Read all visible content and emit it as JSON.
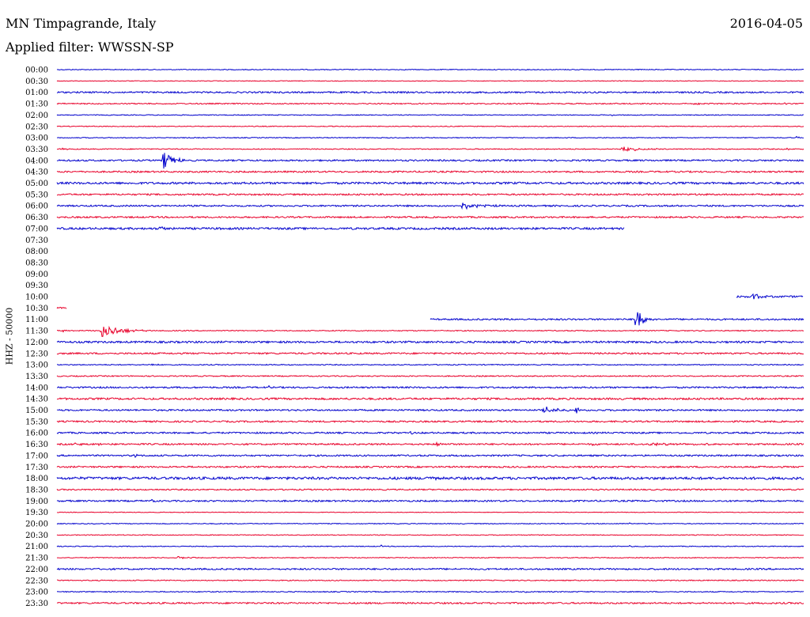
{
  "header": {
    "station": "MN Timpagrande, Italy",
    "date": "2016-04-05",
    "filter_label": "Applied filter: WWSSN-SP"
  },
  "chart_data": {
    "type": "line",
    "ylabel": "HHZ - 50000",
    "colors": {
      "even_hour": "#0000cc",
      "half_hour": "#e8002a"
    },
    "row_minutes": 30,
    "rows": [
      {
        "label": "00:00",
        "start": 0,
        "end": 30,
        "noise": 0.5,
        "events": [
          {
            "t": 20.7,
            "amp": 2,
            "dur": 0.2
          }
        ]
      },
      {
        "label": "00:30",
        "start": 0,
        "end": 30,
        "noise": 0.4,
        "events": []
      },
      {
        "label": "01:00",
        "start": 0,
        "end": 30,
        "noise": 1.0,
        "events": []
      },
      {
        "label": "01:30",
        "start": 0,
        "end": 30,
        "noise": 0.7,
        "events": [
          {
            "t": 25.5,
            "amp": 1.5,
            "dur": 1.0
          },
          {
            "t": 29.2,
            "amp": 2,
            "dur": 0.4
          }
        ]
      },
      {
        "label": "02:00",
        "start": 0,
        "end": 30,
        "noise": 0.5,
        "events": [
          {
            "t": 22.3,
            "amp": 2,
            "dur": 0.1
          }
        ]
      },
      {
        "label": "02:30",
        "start": 0,
        "end": 30,
        "noise": 0.5,
        "events": []
      },
      {
        "label": "03:00",
        "start": 0,
        "end": 30,
        "noise": 0.5,
        "events": [
          {
            "t": 29.7,
            "amp": 2,
            "dur": 0.3
          }
        ]
      },
      {
        "label": "03:30",
        "start": 0,
        "end": 30,
        "noise": 0.6,
        "events": [
          {
            "t": 0.2,
            "amp": 3,
            "dur": 0.3
          },
          {
            "t": 22.6,
            "amp": 5,
            "dur": 1.6
          },
          {
            "t": 29.3,
            "amp": 3,
            "dur": 0.2
          }
        ]
      },
      {
        "label": "04:00",
        "start": 0,
        "end": 30,
        "noise": 1.0,
        "events": [
          {
            "t": 4.2,
            "amp": 14,
            "dur": 1.2
          }
        ]
      },
      {
        "label": "04:30",
        "start": 0,
        "end": 30,
        "noise": 1.0,
        "events": []
      },
      {
        "label": "05:00",
        "start": 0,
        "end": 30,
        "noise": 1.3,
        "events": []
      },
      {
        "label": "05:30",
        "start": 0,
        "end": 30,
        "noise": 1.0,
        "events": [
          {
            "t": 25.8,
            "amp": 2,
            "dur": 0.4
          }
        ]
      },
      {
        "label": "06:00",
        "start": 0,
        "end": 30,
        "noise": 1.0,
        "events": [
          {
            "t": 16.2,
            "amp": 5,
            "dur": 1.8
          }
        ]
      },
      {
        "label": "06:30",
        "start": 0,
        "end": 30,
        "noise": 1.0,
        "events": []
      },
      {
        "label": "07:00",
        "start": 0,
        "end": 22.8,
        "noise": 1.3,
        "events": [
          {
            "t": 4.1,
            "amp": 3,
            "dur": 0.5
          }
        ]
      },
      {
        "label": "07:30",
        "start": 0,
        "end": 0,
        "noise": 0,
        "events": []
      },
      {
        "label": "08:00",
        "start": 0,
        "end": 0,
        "noise": 0,
        "events": []
      },
      {
        "label": "08:30",
        "start": 0,
        "end": 0,
        "noise": 0,
        "events": []
      },
      {
        "label": "09:00",
        "start": 0,
        "end": 0,
        "noise": 0,
        "events": []
      },
      {
        "label": "09:30",
        "start": 0,
        "end": 0,
        "noise": 0,
        "events": []
      },
      {
        "label": "10:00",
        "start": 27.3,
        "end": 30,
        "noise": 1.2,
        "events": [
          {
            "t": 27.9,
            "amp": 5,
            "dur": 1.0
          }
        ]
      },
      {
        "label": "10:30",
        "start": 0,
        "end": 0.4,
        "noise": 1.0,
        "events": []
      },
      {
        "label": "11:00",
        "start": 15.0,
        "end": 30,
        "noise": 1.0,
        "events": [
          {
            "t": 23.2,
            "amp": 22,
            "dur": 0.8
          }
        ]
      },
      {
        "label": "11:30",
        "start": 0,
        "end": 30,
        "noise": 0.6,
        "events": [
          {
            "t": 0.2,
            "amp": 2,
            "dur": 0.4
          },
          {
            "t": 1.7,
            "amp": 10,
            "dur": 2.1
          }
        ]
      },
      {
        "label": "12:00",
        "start": 0,
        "end": 30,
        "noise": 1.2,
        "events": []
      },
      {
        "label": "12:30",
        "start": 0,
        "end": 30,
        "noise": 1.0,
        "events": []
      },
      {
        "label": "13:00",
        "start": 0,
        "end": 30,
        "noise": 0.6,
        "events": [
          {
            "t": 3.8,
            "amp": 2,
            "dur": 0.5
          }
        ]
      },
      {
        "label": "13:30",
        "start": 0,
        "end": 30,
        "noise": 0.7,
        "events": []
      },
      {
        "label": "14:00",
        "start": 0,
        "end": 30,
        "noise": 1.0,
        "events": [
          {
            "t": 8.5,
            "amp": 2,
            "dur": 0.2
          }
        ]
      },
      {
        "label": "14:30",
        "start": 0,
        "end": 30,
        "noise": 1.2,
        "events": []
      },
      {
        "label": "15:00",
        "start": 0,
        "end": 30,
        "noise": 1.0,
        "events": [
          {
            "t": 19.5,
            "amp": 5,
            "dur": 1.5
          },
          {
            "t": 20.8,
            "amp": 6,
            "dur": 0.4
          }
        ]
      },
      {
        "label": "15:30",
        "start": 0,
        "end": 30,
        "noise": 1.0,
        "events": []
      },
      {
        "label": "16:00",
        "start": 0,
        "end": 30,
        "noise": 1.0,
        "events": [
          {
            "t": 14.2,
            "amp": 3,
            "dur": 0.2
          }
        ]
      },
      {
        "label": "16:30",
        "start": 0,
        "end": 30,
        "noise": 1.0,
        "events": [
          {
            "t": 0.6,
            "amp": 4,
            "dur": 0.6
          },
          {
            "t": 1.6,
            "amp": 2,
            "dur": 0.5
          },
          {
            "t": 15.2,
            "amp": 2,
            "dur": 0.6
          },
          {
            "t": 21.5,
            "amp": 2,
            "dur": 0.3
          },
          {
            "t": 23.8,
            "amp": 3,
            "dur": 1.6
          },
          {
            "t": 25.5,
            "amp": 2,
            "dur": 1.2
          }
        ]
      },
      {
        "label": "17:00",
        "start": 0,
        "end": 30,
        "noise": 1.0,
        "events": [
          {
            "t": 3.0,
            "amp": 3,
            "dur": 0.5
          }
        ]
      },
      {
        "label": "17:30",
        "start": 0,
        "end": 30,
        "noise": 1.0,
        "events": []
      },
      {
        "label": "18:00",
        "start": 0,
        "end": 30,
        "noise": 1.6,
        "events": [
          {
            "t": 14.8,
            "amp": 3,
            "dur": 0.8
          }
        ]
      },
      {
        "label": "18:30",
        "start": 0,
        "end": 30,
        "noise": 0.8,
        "events": []
      },
      {
        "label": "19:00",
        "start": 0,
        "end": 30,
        "noise": 1.0,
        "events": [
          {
            "t": 3.8,
            "amp": 3,
            "dur": 0.2
          },
          {
            "t": 5.0,
            "amp": 4,
            "dur": 0.2
          }
        ]
      },
      {
        "label": "19:30",
        "start": 0,
        "end": 30,
        "noise": 0.4,
        "events": []
      },
      {
        "label": "20:00",
        "start": 0,
        "end": 30,
        "noise": 0.5,
        "events": [
          {
            "t": 23.0,
            "amp": 2,
            "dur": 0.2
          }
        ]
      },
      {
        "label": "20:30",
        "start": 0,
        "end": 30,
        "noise": 0.5,
        "events": []
      },
      {
        "label": "21:00",
        "start": 0,
        "end": 30,
        "noise": 0.5,
        "events": [
          {
            "t": 13.0,
            "amp": 2,
            "dur": 0.2
          },
          {
            "t": 22.8,
            "amp": 2,
            "dur": 0.6
          }
        ]
      },
      {
        "label": "21:30",
        "start": 0,
        "end": 30,
        "noise": 0.5,
        "events": [
          {
            "t": 4.8,
            "amp": 2,
            "dur": 1.2
          }
        ]
      },
      {
        "label": "22:00",
        "start": 0,
        "end": 30,
        "noise": 1.0,
        "events": []
      },
      {
        "label": "22:30",
        "start": 0,
        "end": 30,
        "noise": 0.6,
        "events": []
      },
      {
        "label": "23:00",
        "start": 0,
        "end": 30,
        "noise": 0.6,
        "events": [
          {
            "t": 8.3,
            "amp": 2,
            "dur": 0.2
          },
          {
            "t": 18.8,
            "amp": 3,
            "dur": 0.3
          }
        ]
      },
      {
        "label": "23:30",
        "start": 0,
        "end": 30,
        "noise": 1.0,
        "events": []
      }
    ]
  }
}
